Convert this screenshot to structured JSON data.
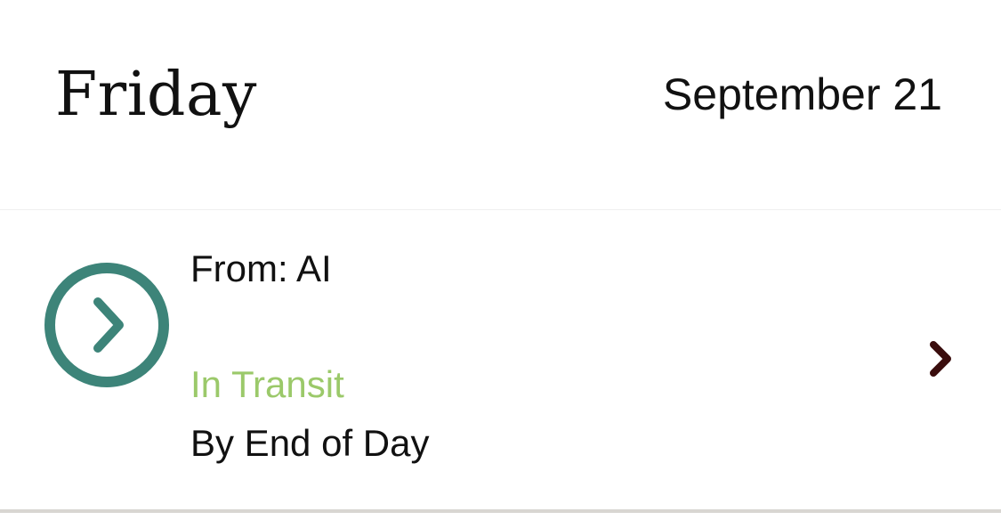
{
  "header": {
    "day": "Friday",
    "date": "September 21"
  },
  "shipment": {
    "from_text": "From: AI",
    "status": "In Transit",
    "eta": "By End of Day",
    "status_color": "#9bc96a",
    "icon_color": "#3d8479",
    "chevron_color": "#3a0d0d",
    "leading_icon": "chevron-right-circle-icon",
    "trailing_icon": "chevron-right-icon"
  }
}
